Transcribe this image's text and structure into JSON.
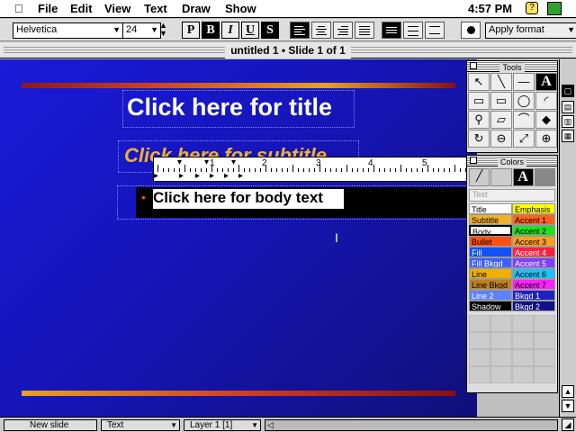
{
  "menubar": {
    "items": [
      "File",
      "Edit",
      "View",
      "Text",
      "Draw",
      "Show"
    ],
    "clock": "4:57 PM"
  },
  "format_toolbar": {
    "font": "Helvetica",
    "size": "24",
    "style_buttons": [
      "P",
      "B",
      "I",
      "U",
      "S"
    ],
    "apply_format": "Apply format"
  },
  "window": {
    "title": "untitled 1 • Slide 1 of 1"
  },
  "slide": {
    "title_placeholder": "Click here for title",
    "subtitle_placeholder": "Click here for subtitle",
    "body_placeholder": "Click here for body text",
    "bullet": "•"
  },
  "ruler": {
    "numbers": [
      "1",
      "2",
      "3",
      "4",
      "5"
    ]
  },
  "tools_palette": {
    "title": "Tools",
    "tools": [
      "↖",
      "╲",
      "—",
      "A",
      "▭",
      "▭",
      "◯",
      "◜",
      "⚲",
      "▱",
      "⌒",
      "◆",
      "↻",
      "⊖",
      "⤢",
      "⊕"
    ]
  },
  "colors_palette": {
    "title": "Colors",
    "text_label": "Text",
    "entries": [
      {
        "label": "Title",
        "bg": "#ffffff",
        "fg": "#000000"
      },
      {
        "label": "Emphasis",
        "bg": "#ffff00",
        "fg": "#000000"
      },
      {
        "label": "Subtitle",
        "bg": "#f0b030",
        "fg": "#000000"
      },
      {
        "label": "Accent 1",
        "bg": "#ff6020",
        "fg": "#000000"
      },
      {
        "label": "Body",
        "bg": "#ffffff",
        "fg": "#000000"
      },
      {
        "label": "Accent 2",
        "bg": "#20e020",
        "fg": "#000000"
      },
      {
        "label": "Bullet",
        "bg": "#ff5010",
        "fg": "#000000"
      },
      {
        "label": "Accent 3",
        "bg": "#ffa020",
        "fg": "#000000"
      },
      {
        "label": "Fill",
        "bg": "#1050ff",
        "fg": "#ffffff"
      },
      {
        "label": "Accent 4",
        "bg": "#ff2040",
        "fg": "#ffffff"
      },
      {
        "label": "Fill Bkgd",
        "bg": "#4060ff",
        "fg": "#ffffff"
      },
      {
        "label": "Accent 5",
        "bg": "#8040ff",
        "fg": "#ffffff"
      },
      {
        "label": "Line",
        "bg": "#f0b000",
        "fg": "#000000"
      },
      {
        "label": "Accent 6",
        "bg": "#20c0ff",
        "fg": "#000000"
      },
      {
        "label": "Line Bkgd",
        "bg": "#c08020",
        "fg": "#000000"
      },
      {
        "label": "Accent 7",
        "bg": "#ff20ff",
        "fg": "#000000"
      },
      {
        "label": "Line 2",
        "bg": "#6080ff",
        "fg": "#ffffff"
      },
      {
        "label": "Bkgd 1",
        "bg": "#2020c0",
        "fg": "#ffffff"
      },
      {
        "label": "Shadow",
        "bg": "#000000",
        "fg": "#ffffff"
      },
      {
        "label": "Bkgd 2",
        "bg": "#10108a",
        "fg": "#ffffff"
      }
    ]
  },
  "statusbar": {
    "view": "New slide",
    "mode": "Text",
    "layer": "Layer 1 [1]"
  }
}
